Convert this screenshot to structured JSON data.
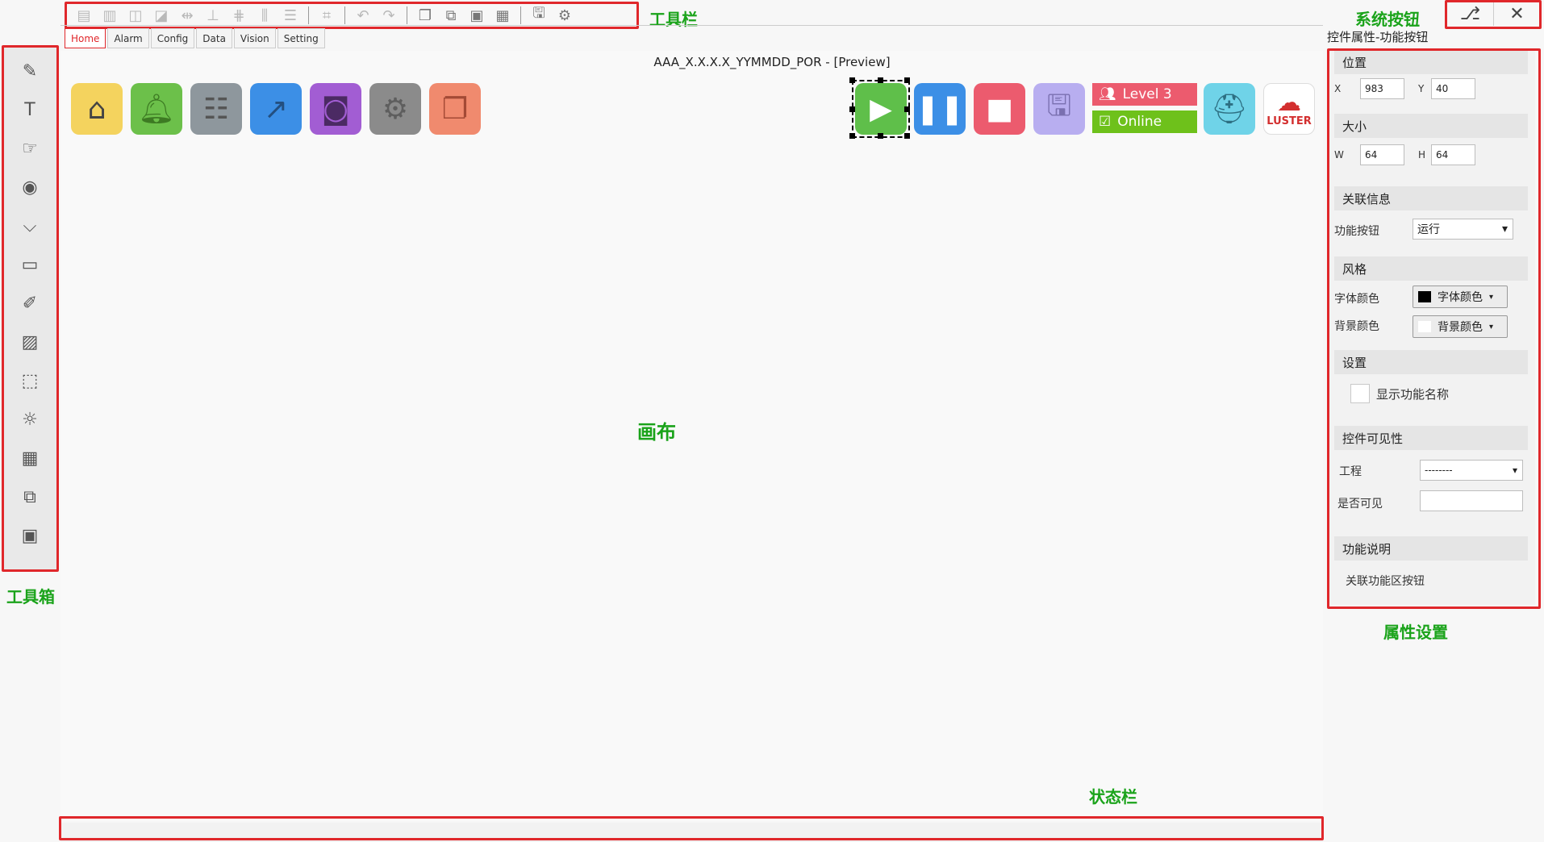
{
  "annotations": {
    "toolbar": "工具栏",
    "system_buttons": "系统按钮",
    "toolbox": "工具箱",
    "canvas": "画布",
    "properties": "属性设置",
    "statusbar": "状态栏"
  },
  "toolbar": {
    "icons": [
      "align-left-icon",
      "align-right-icon",
      "align-top-icon",
      "align-bottom-icon",
      "align-hcenter-icon",
      "align-vcenter-icon",
      "distribute-h-icon",
      "distribute-v-icon",
      "align-middle-icon",
      "grid-icon",
      "undo-icon",
      "redo-icon",
      "copy-icon",
      "paste-icon",
      "clone-icon",
      "clipboard-icon",
      "save-icon",
      "gear-icon"
    ]
  },
  "system_buttons": {
    "icons": [
      "network-icon",
      "close-icon"
    ]
  },
  "tabs": [
    "Home",
    "Alarm",
    "Config",
    "Data",
    "Vision",
    "Setting"
  ],
  "active_tab": "Home",
  "canvas": {
    "title": "AAA_X.X.X.X_YYMMDD_POR - [Preview]",
    "left_icons": [
      {
        "name": "home-icon",
        "color": "#f4d35e"
      },
      {
        "name": "bell-icon",
        "color": "#6cc04a"
      },
      {
        "name": "sliders-icon",
        "color": "#8e979d"
      },
      {
        "name": "chart-line-icon",
        "color": "#3c8fe6"
      },
      {
        "name": "camera-icon",
        "color": "#a25dd3"
      },
      {
        "name": "gear-icon",
        "color": "#8b8b8b"
      },
      {
        "name": "windows-icon",
        "color": "#f08a6e"
      }
    ],
    "right_icons": [
      {
        "name": "play-icon",
        "color": "#5fbf4a"
      },
      {
        "name": "pause-icon",
        "color": "#3c8fe6"
      },
      {
        "name": "stop-icon",
        "color": "#ec5b6e"
      },
      {
        "name": "save-icon",
        "color": "#b8aef0"
      },
      {
        "name": "engineer-icon",
        "color": "#6fd3e8"
      },
      {
        "name": "luster-logo-icon",
        "color": "#d32f2f"
      }
    ],
    "level_label": "Level 3",
    "level_color": "#ec5b6e",
    "online_label": "Online",
    "online_color": "#6ec11b",
    "logo_text": "LUSTER"
  },
  "props": {
    "header": "控件属性-功能按钮",
    "position": {
      "title": "位置",
      "x_label": "X",
      "x": "983",
      "y_label": "Y",
      "y": "40"
    },
    "size": {
      "title": "大小",
      "w_label": "W",
      "w": "64",
      "h_label": "H",
      "h": "64"
    },
    "relation": {
      "title": "关联信息",
      "label": "功能按钮",
      "value": "运行"
    },
    "style": {
      "title": "风格",
      "font_label": "字体颜色",
      "font_btn": "字体颜色",
      "font_color": "#000000",
      "bg_label": "背景颜色",
      "bg_btn": "背景颜色",
      "bg_color": "#ffffff"
    },
    "settings": {
      "title": "设置",
      "checkbox_label": "显示功能名称",
      "checked": false
    },
    "visibility": {
      "title": "控件可见性",
      "project_label": "工程",
      "project_value": "--------",
      "visible_label": "是否可见",
      "visible_value": ""
    },
    "description": {
      "title": "功能说明",
      "text": "关联功能区按钮"
    }
  }
}
